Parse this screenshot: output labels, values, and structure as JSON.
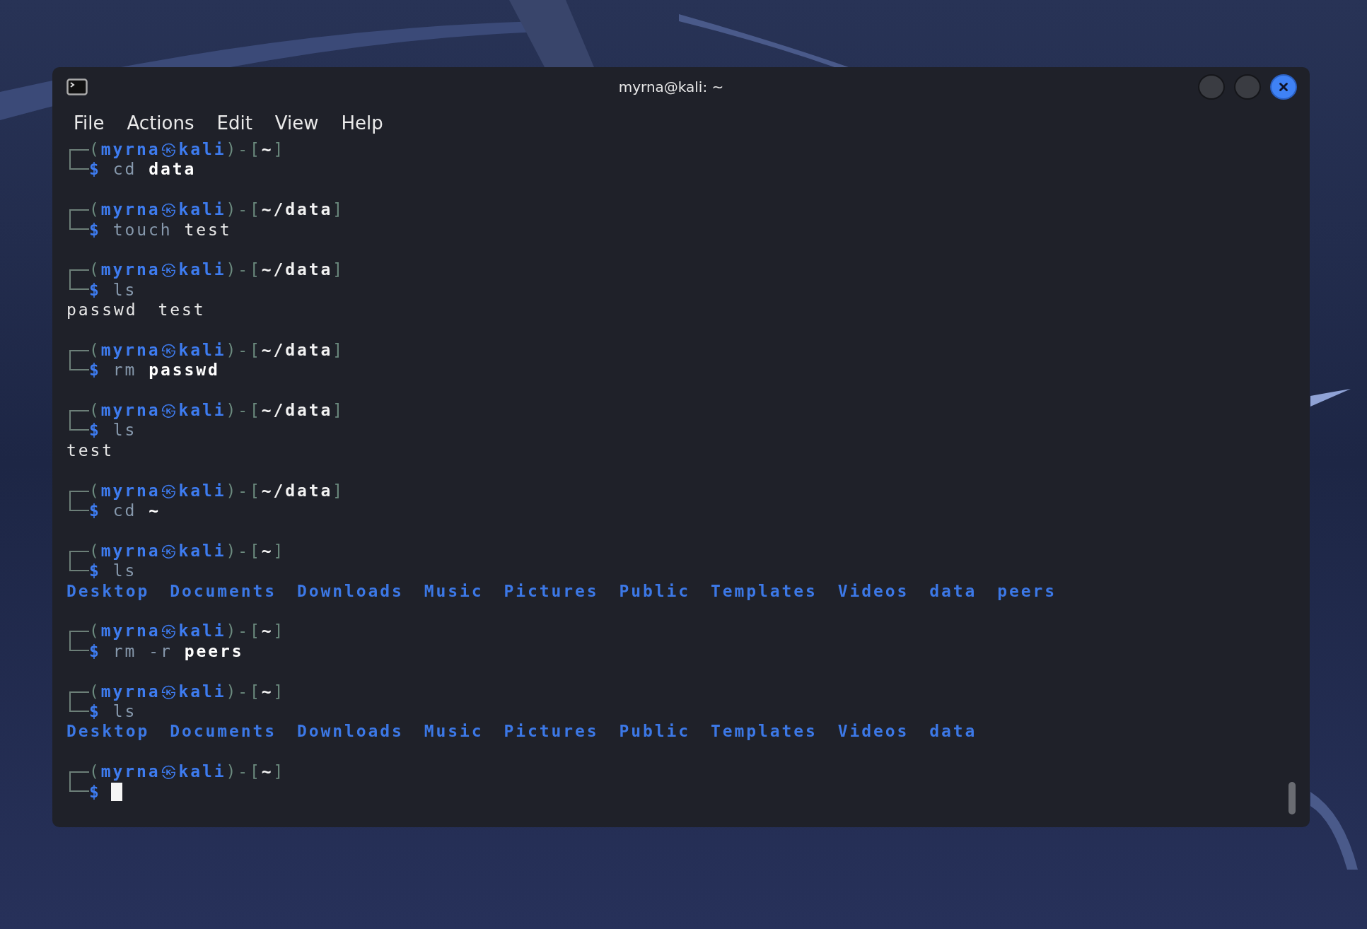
{
  "window": {
    "title": "myrna@kali: ~"
  },
  "menu": [
    "File",
    "Actions",
    "Edit",
    "View",
    "Help"
  ],
  "blocks": [
    {
      "prompt": {
        "open": "(",
        "user": "myrna",
        "mark": "㉿",
        "host": "kali",
        "mid": ")-[",
        "path": "~",
        "close": "]",
        "symbol": "$"
      },
      "command": "cd",
      "args": [
        {
          "text": "data",
          "bold": true
        }
      ]
    },
    {
      "prompt": {
        "open": "(",
        "user": "myrna",
        "mark": "㉿",
        "host": "kali",
        "mid": ")-[",
        "path": "~/data",
        "close": "]",
        "symbol": "$"
      },
      "command": "touch",
      "args": [
        {
          "text": "test",
          "bold": false
        }
      ]
    },
    {
      "prompt": {
        "open": "(",
        "user": "myrna",
        "mark": "㉿",
        "host": "kali",
        "mid": ")-[",
        "path": "~/data",
        "close": "]",
        "symbol": "$"
      },
      "command": "ls",
      "output": [
        {
          "name": "passwd",
          "kind": "file"
        },
        {
          "name": "test",
          "kind": "file"
        }
      ]
    },
    {
      "prompt": {
        "open": "(",
        "user": "myrna",
        "mark": "㉿",
        "host": "kali",
        "mid": ")-[",
        "path": "~/data",
        "close": "]",
        "symbol": "$"
      },
      "command": "rm",
      "args": [
        {
          "text": "passwd",
          "bold": true
        }
      ]
    },
    {
      "prompt": {
        "open": "(",
        "user": "myrna",
        "mark": "㉿",
        "host": "kali",
        "mid": ")-[",
        "path": "~/data",
        "close": "]",
        "symbol": "$"
      },
      "command": "ls",
      "output": [
        {
          "name": "test",
          "kind": "file"
        }
      ]
    },
    {
      "prompt": {
        "open": "(",
        "user": "myrna",
        "mark": "㉿",
        "host": "kali",
        "mid": ")-[",
        "path": "~/data",
        "close": "]",
        "symbol": "$"
      },
      "command": "cd",
      "args": [
        {
          "text": "~",
          "bold": true
        }
      ]
    },
    {
      "prompt": {
        "open": "(",
        "user": "myrna",
        "mark": "㉿",
        "host": "kali",
        "mid": ")-[",
        "path": "~",
        "close": "]",
        "symbol": "$"
      },
      "command": "ls",
      "output": [
        {
          "name": "Desktop",
          "kind": "dir"
        },
        {
          "name": "Documents",
          "kind": "dir"
        },
        {
          "name": "Downloads",
          "kind": "dir"
        },
        {
          "name": "Music",
          "kind": "dir"
        },
        {
          "name": "Pictures",
          "kind": "dir"
        },
        {
          "name": "Public",
          "kind": "dir"
        },
        {
          "name": "Templates",
          "kind": "dir"
        },
        {
          "name": "Videos",
          "kind": "dir"
        },
        {
          "name": "data",
          "kind": "dir"
        },
        {
          "name": "peers",
          "kind": "dir"
        }
      ]
    },
    {
      "prompt": {
        "open": "(",
        "user": "myrna",
        "mark": "㉿",
        "host": "kali",
        "mid": ")-[",
        "path": "~",
        "close": "]",
        "symbol": "$"
      },
      "command": "rm",
      "args": [
        {
          "text": "-r",
          "dim": true
        },
        {
          "text": "peers",
          "bold": true
        }
      ]
    },
    {
      "prompt": {
        "open": "(",
        "user": "myrna",
        "mark": "㉿",
        "host": "kali",
        "mid": ")-[",
        "path": "~",
        "close": "]",
        "symbol": "$"
      },
      "command": "ls",
      "output": [
        {
          "name": "Desktop",
          "kind": "dir"
        },
        {
          "name": "Documents",
          "kind": "dir"
        },
        {
          "name": "Downloads",
          "kind": "dir"
        },
        {
          "name": "Music",
          "kind": "dir"
        },
        {
          "name": "Pictures",
          "kind": "dir"
        },
        {
          "name": "Public",
          "kind": "dir"
        },
        {
          "name": "Templates",
          "kind": "dir"
        },
        {
          "name": "Videos",
          "kind": "dir"
        },
        {
          "name": "data",
          "kind": "dir"
        }
      ]
    },
    {
      "prompt": {
        "open": "(",
        "user": "myrna",
        "mark": "㉿",
        "host": "kali",
        "mid": ")-[",
        "path": "~",
        "close": "]",
        "symbol": "$"
      },
      "cursor": true
    }
  ]
}
